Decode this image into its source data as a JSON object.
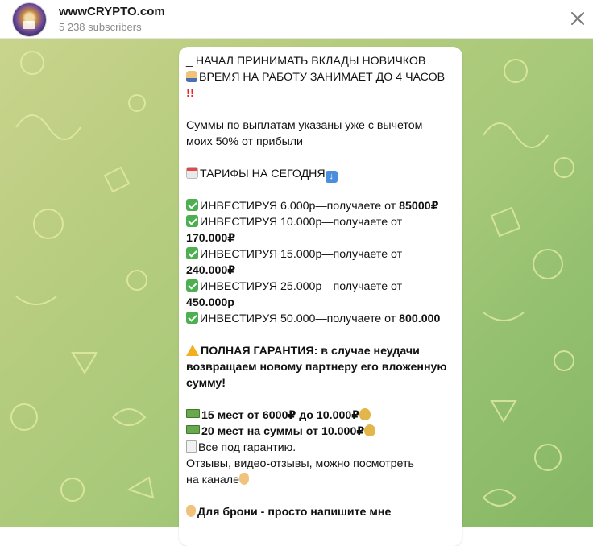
{
  "header": {
    "channel_title": "wwwCRYPTO.com",
    "subscribers": "5 238 subscribers"
  },
  "message": {
    "lines": [
      {
        "emoji": "",
        "parts": [
          {
            "t": "_ НАЧАЛ ПРИНИМАТЬ ВКЛАДЫ НОВИЧКОВ",
            "b": false
          }
        ]
      },
      {
        "emoji": "user",
        "parts": [
          {
            "t": "ВРЕМЯ НА РАБОТУ ЗАНИМАЕТ ДО 4 ЧАСОВ",
            "b": false
          }
        ]
      },
      {
        "emoji": "excl",
        "parts": []
      },
      {
        "gap": true
      },
      {
        "emoji": "",
        "parts": [
          {
            "t": "Суммы по выплатам указаны уже с вычетом",
            "b": false
          }
        ]
      },
      {
        "emoji": "",
        "parts": [
          {
            "t": "моих 50% от прибыли",
            "b": false
          }
        ]
      },
      {
        "gap": true
      },
      {
        "emoji": "cal",
        "parts": [
          {
            "t": "ТАРИФЫ НА СЕГОДНЯ",
            "b": false
          }
        ],
        "trail": "down"
      },
      {
        "gap": true
      },
      {
        "emoji": "check",
        "parts": [
          {
            "t": "ИНВЕСТИРУЯ 6.000р—получаете от ",
            "b": false
          },
          {
            "t": "85000₽",
            "b": true
          }
        ]
      },
      {
        "emoji": "check",
        "parts": [
          {
            "t": "ИНВЕСТИРУЯ 10.000р—получаете от",
            "b": false
          }
        ]
      },
      {
        "emoji": "",
        "parts": [
          {
            "t": "170.000₽",
            "b": true
          }
        ]
      },
      {
        "emoji": "check",
        "parts": [
          {
            "t": "ИНВЕСТИРУЯ 15.000р—получаете от",
            "b": false
          }
        ]
      },
      {
        "emoji": "",
        "parts": [
          {
            "t": "240.000₽",
            "b": true
          }
        ]
      },
      {
        "emoji": "check",
        "parts": [
          {
            "t": "ИНВЕСТИРУЯ 25.000р—получаете от",
            "b": false
          }
        ]
      },
      {
        "emoji": "",
        "parts": [
          {
            "t": "450.000р",
            "b": true
          }
        ]
      },
      {
        "emoji": "check",
        "parts": [
          {
            "t": "ИНВЕСТИРУЯ 50.000—получаете от ",
            "b": false
          },
          {
            "t": "800.000",
            "b": true
          }
        ]
      },
      {
        "gap": true
      },
      {
        "emoji": "warn",
        "parts": [
          {
            "t": "ПОЛНАЯ ГАРАНТИЯ: в случае неудачи",
            "b": true
          }
        ]
      },
      {
        "emoji": "",
        "parts": [
          {
            "t": "возвращаем новому партнеру его вложенную",
            "b": true
          }
        ]
      },
      {
        "emoji": "",
        "parts": [
          {
            "t": "сумму!",
            "b": true
          }
        ]
      },
      {
        "gap": true
      },
      {
        "emoji": "cash",
        "parts": [
          {
            "t": "15 мест от 6000₽ до 10.000₽",
            "b": true
          }
        ],
        "trail": "bag"
      },
      {
        "emoji": "cash",
        "parts": [
          {
            "t": "20 мест на суммы от 10.000₽",
            "b": true
          }
        ],
        "trail": "bag"
      },
      {
        "emoji": "doc",
        "parts": [
          {
            "t": "Все под гарантию.",
            "b": false
          }
        ]
      },
      {
        "emoji": "",
        "parts": [
          {
            "t": "Отзывы, видео-отзывы, можно посмотреть",
            "b": false
          }
        ]
      },
      {
        "emoji": "",
        "parts": [
          {
            "t": "на канале",
            "b": false
          }
        ],
        "trail": "hand"
      },
      {
        "gap": true
      },
      {
        "emoji": "hand",
        "parts": [
          {
            "t": "Для брони - просто напишите мне",
            "b": true
          }
        ]
      }
    ]
  }
}
